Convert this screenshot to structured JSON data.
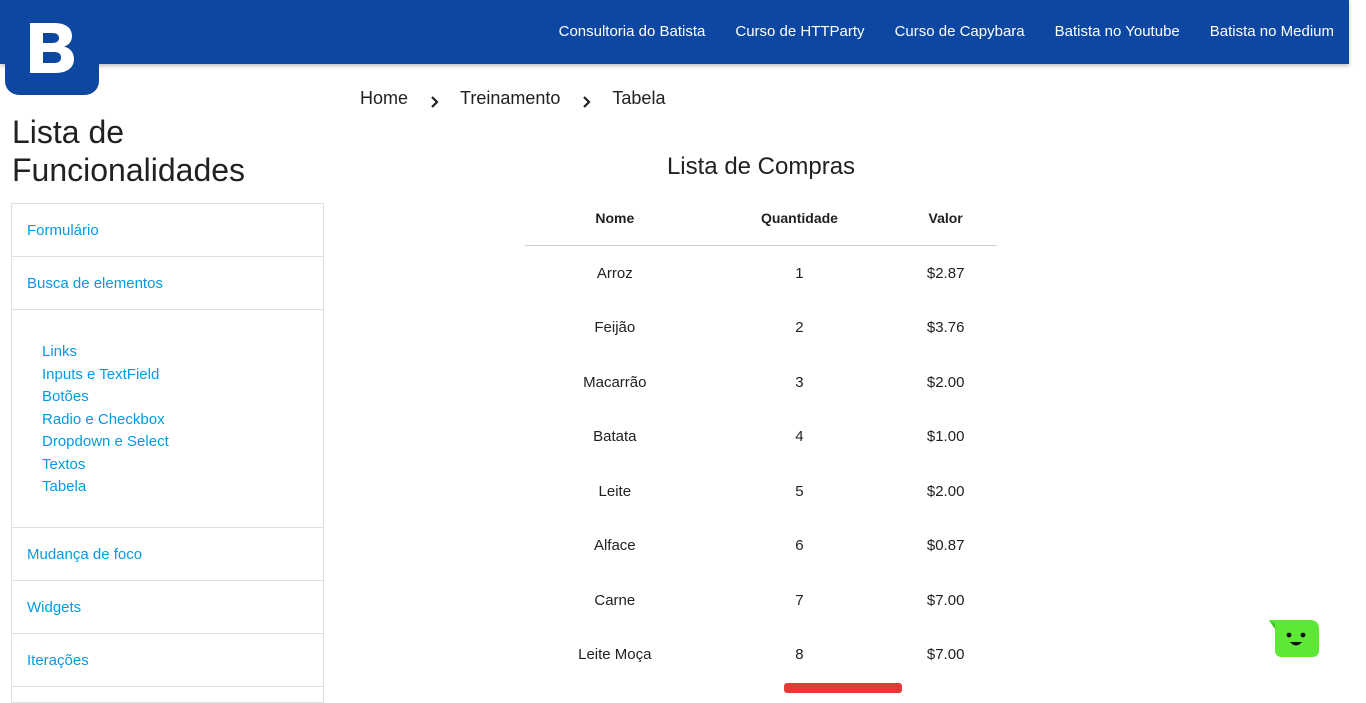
{
  "header": {
    "logo_letter": "B",
    "nav": [
      "Consultoria do Batista",
      "Curso de HTTParty",
      "Curso de Capybara",
      "Batista no Youtube",
      "Batista no Medium"
    ]
  },
  "sidebar": {
    "title": "Lista de Funcionalidades",
    "items_top": [
      "Formulário",
      "Busca de elementos"
    ],
    "sub_items": [
      "Links",
      "Inputs e TextField",
      "Botões",
      "Radio e Checkbox",
      "Dropdown e Select",
      "Textos",
      "Tabela"
    ],
    "items_bottom": [
      "Mudança de foco",
      "Widgets",
      "Iterações"
    ]
  },
  "breadcrumb": [
    "Home",
    "Treinamento",
    "Tabela"
  ],
  "table": {
    "title": "Lista de Compras",
    "headers": [
      "Nome",
      "Quantidade",
      "Valor"
    ],
    "rows": [
      [
        "Arroz",
        "1",
        "$2.87"
      ],
      [
        "Feijão",
        "2",
        "$3.76"
      ],
      [
        "Macarrão",
        "3",
        "$2.00"
      ],
      [
        "Batata",
        "4",
        "$1.00"
      ],
      [
        "Leite",
        "5",
        "$2.00"
      ],
      [
        "Alface",
        "6",
        "$0.87"
      ],
      [
        "Carne",
        "7",
        "$7.00"
      ],
      [
        "Leite Moça",
        "8",
        "$7.00"
      ]
    ]
  },
  "colors": {
    "navbar": "#0d47a1",
    "link": "#039be5",
    "chat": "#5de836",
    "button": "#e53935"
  }
}
